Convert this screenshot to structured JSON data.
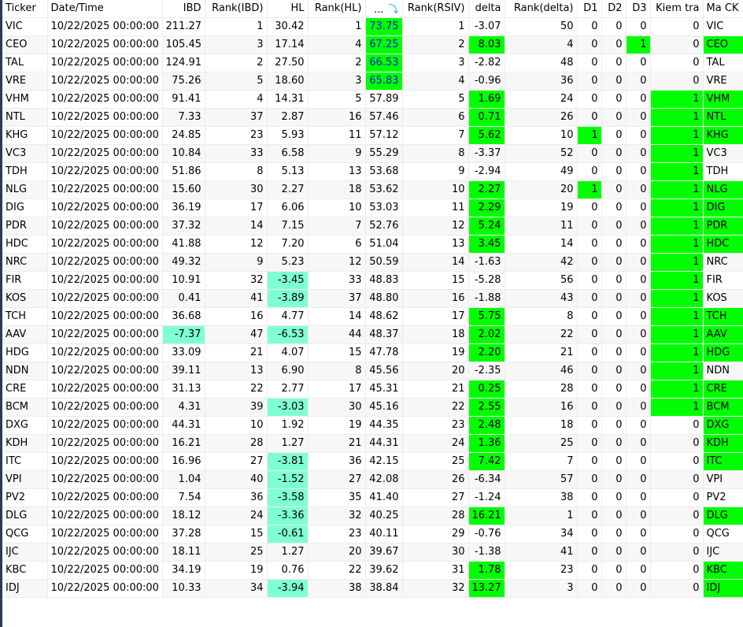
{
  "columns": [
    {
      "key": "ticker",
      "label": "Ticker",
      "align": "txt"
    },
    {
      "key": "dt",
      "label": "Date/Time",
      "align": "txt"
    },
    {
      "key": "ibd",
      "label": "IBD",
      "align": "num"
    },
    {
      "key": "rank_ibd",
      "label": "Rank(IBD)",
      "align": "num"
    },
    {
      "key": "hl",
      "label": "HL",
      "align": "num"
    },
    {
      "key": "rank_hl",
      "label": "Rank(HL)",
      "align": "num"
    },
    {
      "key": "rsi",
      "label": "...",
      "align": "num",
      "sorted": "sort-descending-icon"
    },
    {
      "key": "rank_rsiv",
      "label": "Rank(RSIV)",
      "align": "num"
    },
    {
      "key": "delta",
      "label": "delta",
      "align": "num"
    },
    {
      "key": "rank_delta",
      "label": "Rank(delta)",
      "align": "num"
    },
    {
      "key": "d1",
      "label": "D1",
      "align": "num"
    },
    {
      "key": "d2",
      "label": "D2",
      "align": "num"
    },
    {
      "key": "d3",
      "label": "D3",
      "align": "num"
    },
    {
      "key": "kiem_tra",
      "label": "Kiem tra",
      "align": "num"
    },
    {
      "key": "ma_ck",
      "label": "Ma CK",
      "align": "txt"
    }
  ],
  "colors": {
    "green": "#00ff00",
    "aquamarine": "#7fffd4",
    "blue_text": "#1515e0"
  },
  "rows": [
    {
      "ticker": "VIC",
      "dt": "10/22/2025 00:00:00",
      "ibd": "211.27",
      "rank_ibd": "1",
      "hl": "30.42",
      "rank_hl": "1",
      "rsi": "73.75",
      "rank_rsiv": "1",
      "delta": "-3.07",
      "rank_delta": "50",
      "d1": "0",
      "d2": "0",
      "d3": "0",
      "kiem_tra": "0",
      "ma_ck": "VIC",
      "green": [
        "rsi"
      ],
      "aqua": []
    },
    {
      "ticker": "CEO",
      "dt": "10/22/2025 00:00:00",
      "ibd": "105.45",
      "rank_ibd": "3",
      "hl": "17.14",
      "rank_hl": "4",
      "rsi": "67.25",
      "rank_rsiv": "2",
      "delta": "8.03",
      "rank_delta": "4",
      "d1": "0",
      "d2": "0",
      "d3": "1",
      "kiem_tra": "0",
      "ma_ck": "CEO",
      "green": [
        "rsi",
        "delta",
        "d3",
        "ma_ck"
      ],
      "aqua": []
    },
    {
      "ticker": "TAL",
      "dt": "10/22/2025 00:00:00",
      "ibd": "124.91",
      "rank_ibd": "2",
      "hl": "27.50",
      "rank_hl": "2",
      "rsi": "66.53",
      "rank_rsiv": "3",
      "delta": "-2.82",
      "rank_delta": "48",
      "d1": "0",
      "d2": "0",
      "d3": "0",
      "kiem_tra": "0",
      "ma_ck": "TAL",
      "green": [
        "rsi"
      ],
      "aqua": []
    },
    {
      "ticker": "VRE",
      "dt": "10/22/2025 00:00:00",
      "ibd": "75.26",
      "rank_ibd": "5",
      "hl": "18.60",
      "rank_hl": "3",
      "rsi": "65.83",
      "rank_rsiv": "4",
      "delta": "-0.96",
      "rank_delta": "36",
      "d1": "0",
      "d2": "0",
      "d3": "0",
      "kiem_tra": "0",
      "ma_ck": "VRE",
      "green": [
        "rsi"
      ],
      "aqua": []
    },
    {
      "ticker": "VHM",
      "dt": "10/22/2025 00:00:00",
      "ibd": "91.41",
      "rank_ibd": "4",
      "hl": "14.31",
      "rank_hl": "5",
      "rsi": "57.89",
      "rank_rsiv": "5",
      "delta": "1.69",
      "rank_delta": "24",
      "d1": "0",
      "d2": "0",
      "d3": "0",
      "kiem_tra": "1",
      "ma_ck": "VHM",
      "green": [
        "delta",
        "kiem_tra",
        "ma_ck"
      ],
      "aqua": []
    },
    {
      "ticker": "NTL",
      "dt": "10/22/2025 00:00:00",
      "ibd": "7.33",
      "rank_ibd": "37",
      "hl": "2.87",
      "rank_hl": "16",
      "rsi": "57.46",
      "rank_rsiv": "6",
      "delta": "0.71",
      "rank_delta": "26",
      "d1": "0",
      "d2": "0",
      "d3": "0",
      "kiem_tra": "1",
      "ma_ck": "NTL",
      "green": [
        "delta",
        "kiem_tra",
        "ma_ck"
      ],
      "aqua": []
    },
    {
      "ticker": "KHG",
      "dt": "10/22/2025 00:00:00",
      "ibd": "24.85",
      "rank_ibd": "23",
      "hl": "5.93",
      "rank_hl": "11",
      "rsi": "57.12",
      "rank_rsiv": "7",
      "delta": "5.62",
      "rank_delta": "10",
      "d1": "1",
      "d2": "0",
      "d3": "0",
      "kiem_tra": "1",
      "ma_ck": "KHG",
      "green": [
        "delta",
        "d1",
        "kiem_tra",
        "ma_ck"
      ],
      "aqua": []
    },
    {
      "ticker": "VC3",
      "dt": "10/22/2025 00:00:00",
      "ibd": "10.84",
      "rank_ibd": "33",
      "hl": "6.58",
      "rank_hl": "9",
      "rsi": "55.29",
      "rank_rsiv": "8",
      "delta": "-3.37",
      "rank_delta": "52",
      "d1": "0",
      "d2": "0",
      "d3": "0",
      "kiem_tra": "1",
      "ma_ck": "VC3",
      "green": [
        "kiem_tra"
      ],
      "aqua": []
    },
    {
      "ticker": "TDH",
      "dt": "10/22/2025 00:00:00",
      "ibd": "51.86",
      "rank_ibd": "8",
      "hl": "5.13",
      "rank_hl": "13",
      "rsi": "53.68",
      "rank_rsiv": "9",
      "delta": "-2.94",
      "rank_delta": "49",
      "d1": "0",
      "d2": "0",
      "d3": "0",
      "kiem_tra": "1",
      "ma_ck": "TDH",
      "green": [
        "kiem_tra"
      ],
      "aqua": []
    },
    {
      "ticker": "NLG",
      "dt": "10/22/2025 00:00:00",
      "ibd": "15.60",
      "rank_ibd": "30",
      "hl": "2.27",
      "rank_hl": "18",
      "rsi": "53.62",
      "rank_rsiv": "10",
      "delta": "2.27",
      "rank_delta": "20",
      "d1": "1",
      "d2": "0",
      "d3": "0",
      "kiem_tra": "1",
      "ma_ck": "NLG",
      "green": [
        "delta",
        "d1",
        "kiem_tra",
        "ma_ck"
      ],
      "aqua": []
    },
    {
      "ticker": "DIG",
      "dt": "10/22/2025 00:00:00",
      "ibd": "36.19",
      "rank_ibd": "17",
      "hl": "6.06",
      "rank_hl": "10",
      "rsi": "53.03",
      "rank_rsiv": "11",
      "delta": "2.29",
      "rank_delta": "19",
      "d1": "0",
      "d2": "0",
      "d3": "0",
      "kiem_tra": "1",
      "ma_ck": "DIG",
      "green": [
        "delta",
        "kiem_tra",
        "ma_ck"
      ],
      "aqua": []
    },
    {
      "ticker": "PDR",
      "dt": "10/22/2025 00:00:00",
      "ibd": "37.32",
      "rank_ibd": "14",
      "hl": "7.15",
      "rank_hl": "7",
      "rsi": "52.76",
      "rank_rsiv": "12",
      "delta": "5.24",
      "rank_delta": "11",
      "d1": "0",
      "d2": "0",
      "d3": "0",
      "kiem_tra": "1",
      "ma_ck": "PDR",
      "green": [
        "delta",
        "kiem_tra",
        "ma_ck"
      ],
      "aqua": []
    },
    {
      "ticker": "HDC",
      "dt": "10/22/2025 00:00:00",
      "ibd": "41.88",
      "rank_ibd": "12",
      "hl": "7.20",
      "rank_hl": "6",
      "rsi": "51.04",
      "rank_rsiv": "13",
      "delta": "3.45",
      "rank_delta": "14",
      "d1": "0",
      "d2": "0",
      "d3": "0",
      "kiem_tra": "1",
      "ma_ck": "HDC",
      "green": [
        "delta",
        "kiem_tra",
        "ma_ck"
      ],
      "aqua": []
    },
    {
      "ticker": "NRC",
      "dt": "10/22/2025 00:00:00",
      "ibd": "49.32",
      "rank_ibd": "9",
      "hl": "5.23",
      "rank_hl": "12",
      "rsi": "50.59",
      "rank_rsiv": "14",
      "delta": "-1.63",
      "rank_delta": "42",
      "d1": "0",
      "d2": "0",
      "d3": "0",
      "kiem_tra": "1",
      "ma_ck": "NRC",
      "green": [
        "kiem_tra"
      ],
      "aqua": []
    },
    {
      "ticker": "FIR",
      "dt": "10/22/2025 00:00:00",
      "ibd": "10.91",
      "rank_ibd": "32",
      "hl": "-3.45",
      "rank_hl": "33",
      "rsi": "48.83",
      "rank_rsiv": "15",
      "delta": "-5.28",
      "rank_delta": "56",
      "d1": "0",
      "d2": "0",
      "d3": "0",
      "kiem_tra": "1",
      "ma_ck": "FIR",
      "green": [
        "kiem_tra"
      ],
      "aqua": [
        "hl"
      ]
    },
    {
      "ticker": "KOS",
      "dt": "10/22/2025 00:00:00",
      "ibd": "0.41",
      "rank_ibd": "41",
      "hl": "-3.89",
      "rank_hl": "37",
      "rsi": "48.80",
      "rank_rsiv": "16",
      "delta": "-1.88",
      "rank_delta": "43",
      "d1": "0",
      "d2": "0",
      "d3": "0",
      "kiem_tra": "1",
      "ma_ck": "KOS",
      "green": [
        "kiem_tra"
      ],
      "aqua": [
        "hl"
      ]
    },
    {
      "ticker": "TCH",
      "dt": "10/22/2025 00:00:00",
      "ibd": "36.68",
      "rank_ibd": "16",
      "hl": "4.77",
      "rank_hl": "14",
      "rsi": "48.62",
      "rank_rsiv": "17",
      "delta": "5.75",
      "rank_delta": "8",
      "d1": "0",
      "d2": "0",
      "d3": "0",
      "kiem_tra": "1",
      "ma_ck": "TCH",
      "green": [
        "delta",
        "kiem_tra",
        "ma_ck"
      ],
      "aqua": []
    },
    {
      "ticker": "AAV",
      "dt": "10/22/2025 00:00:00",
      "ibd": "-7.37",
      "rank_ibd": "47",
      "hl": "-6.53",
      "rank_hl": "44",
      "rsi": "48.37",
      "rank_rsiv": "18",
      "delta": "2.02",
      "rank_delta": "22",
      "d1": "0",
      "d2": "0",
      "d3": "0",
      "kiem_tra": "1",
      "ma_ck": "AAV",
      "green": [
        "delta",
        "kiem_tra",
        "ma_ck"
      ],
      "aqua": [
        "ibd",
        "hl"
      ]
    },
    {
      "ticker": "HDG",
      "dt": "10/22/2025 00:00:00",
      "ibd": "33.09",
      "rank_ibd": "21",
      "hl": "4.07",
      "rank_hl": "15",
      "rsi": "47.78",
      "rank_rsiv": "19",
      "delta": "2.20",
      "rank_delta": "21",
      "d1": "0",
      "d2": "0",
      "d3": "0",
      "kiem_tra": "1",
      "ma_ck": "HDG",
      "green": [
        "delta",
        "kiem_tra",
        "ma_ck"
      ],
      "aqua": []
    },
    {
      "ticker": "NDN",
      "dt": "10/22/2025 00:00:00",
      "ibd": "39.11",
      "rank_ibd": "13",
      "hl": "6.90",
      "rank_hl": "8",
      "rsi": "45.56",
      "rank_rsiv": "20",
      "delta": "-2.35",
      "rank_delta": "46",
      "d1": "0",
      "d2": "0",
      "d3": "0",
      "kiem_tra": "1",
      "ma_ck": "NDN",
      "green": [
        "kiem_tra"
      ],
      "aqua": []
    },
    {
      "ticker": "CRE",
      "dt": "10/22/2025 00:00:00",
      "ibd": "31.13",
      "rank_ibd": "22",
      "hl": "2.77",
      "rank_hl": "17",
      "rsi": "45.31",
      "rank_rsiv": "21",
      "delta": "0.25",
      "rank_delta": "28",
      "d1": "0",
      "d2": "0",
      "d3": "0",
      "kiem_tra": "1",
      "ma_ck": "CRE",
      "green": [
        "delta",
        "kiem_tra",
        "ma_ck"
      ],
      "aqua": []
    },
    {
      "ticker": "BCM",
      "dt": "10/22/2025 00:00:00",
      "ibd": "4.31",
      "rank_ibd": "39",
      "hl": "-3.03",
      "rank_hl": "30",
      "rsi": "45.16",
      "rank_rsiv": "22",
      "delta": "2.55",
      "rank_delta": "16",
      "d1": "0",
      "d2": "0",
      "d3": "0",
      "kiem_tra": "1",
      "ma_ck": "BCM",
      "green": [
        "delta",
        "kiem_tra",
        "ma_ck"
      ],
      "aqua": [
        "hl"
      ]
    },
    {
      "ticker": "DXG",
      "dt": "10/22/2025 00:00:00",
      "ibd": "44.31",
      "rank_ibd": "10",
      "hl": "1.92",
      "rank_hl": "19",
      "rsi": "44.35",
      "rank_rsiv": "23",
      "delta": "2.48",
      "rank_delta": "18",
      "d1": "0",
      "d2": "0",
      "d3": "0",
      "kiem_tra": "0",
      "ma_ck": "DXG",
      "green": [
        "delta",
        "ma_ck"
      ],
      "aqua": []
    },
    {
      "ticker": "KDH",
      "dt": "10/22/2025 00:00:00",
      "ibd": "16.21",
      "rank_ibd": "28",
      "hl": "1.27",
      "rank_hl": "21",
      "rsi": "44.31",
      "rank_rsiv": "24",
      "delta": "1.36",
      "rank_delta": "25",
      "d1": "0",
      "d2": "0",
      "d3": "0",
      "kiem_tra": "0",
      "ma_ck": "KDH",
      "green": [
        "delta",
        "ma_ck"
      ],
      "aqua": []
    },
    {
      "ticker": "ITC",
      "dt": "10/22/2025 00:00:00",
      "ibd": "16.96",
      "rank_ibd": "27",
      "hl": "-3.81",
      "rank_hl": "36",
      "rsi": "42.15",
      "rank_rsiv": "25",
      "delta": "7.42",
      "rank_delta": "7",
      "d1": "0",
      "d2": "0",
      "d3": "0",
      "kiem_tra": "0",
      "ma_ck": "ITC",
      "green": [
        "delta",
        "ma_ck"
      ],
      "aqua": [
        "hl"
      ]
    },
    {
      "ticker": "VPI",
      "dt": "10/22/2025 00:00:00",
      "ibd": "1.04",
      "rank_ibd": "40",
      "hl": "-1.52",
      "rank_hl": "27",
      "rsi": "42.08",
      "rank_rsiv": "26",
      "delta": "-6.34",
      "rank_delta": "57",
      "d1": "0",
      "d2": "0",
      "d3": "0",
      "kiem_tra": "0",
      "ma_ck": "VPI",
      "green": [],
      "aqua": [
        "hl"
      ]
    },
    {
      "ticker": "PV2",
      "dt": "10/22/2025 00:00:00",
      "ibd": "7.54",
      "rank_ibd": "36",
      "hl": "-3.58",
      "rank_hl": "35",
      "rsi": "41.40",
      "rank_rsiv": "27",
      "delta": "-1.24",
      "rank_delta": "38",
      "d1": "0",
      "d2": "0",
      "d3": "0",
      "kiem_tra": "0",
      "ma_ck": "PV2",
      "green": [],
      "aqua": [
        "hl"
      ]
    },
    {
      "ticker": "DLG",
      "dt": "10/22/2025 00:00:00",
      "ibd": "18.12",
      "rank_ibd": "24",
      "hl": "-3.36",
      "rank_hl": "32",
      "rsi": "40.25",
      "rank_rsiv": "28",
      "delta": "16.21",
      "rank_delta": "1",
      "d1": "0",
      "d2": "0",
      "d3": "0",
      "kiem_tra": "0",
      "ma_ck": "DLG",
      "green": [
        "delta",
        "ma_ck"
      ],
      "aqua": [
        "hl"
      ]
    },
    {
      "ticker": "QCG",
      "dt": "10/22/2025 00:00:00",
      "ibd": "37.28",
      "rank_ibd": "15",
      "hl": "-0.61",
      "rank_hl": "23",
      "rsi": "40.11",
      "rank_rsiv": "29",
      "delta": "-0.76",
      "rank_delta": "34",
      "d1": "0",
      "d2": "0",
      "d3": "0",
      "kiem_tra": "0",
      "ma_ck": "QCG",
      "green": [],
      "aqua": [
        "hl"
      ]
    },
    {
      "ticker": "IJC",
      "dt": "10/22/2025 00:00:00",
      "ibd": "18.11",
      "rank_ibd": "25",
      "hl": "1.27",
      "rank_hl": "20",
      "rsi": "39.67",
      "rank_rsiv": "30",
      "delta": "-1.38",
      "rank_delta": "41",
      "d1": "0",
      "d2": "0",
      "d3": "0",
      "kiem_tra": "0",
      "ma_ck": "IJC",
      "green": [],
      "aqua": []
    },
    {
      "ticker": "KBC",
      "dt": "10/22/2025 00:00:00",
      "ibd": "34.19",
      "rank_ibd": "19",
      "hl": "0.76",
      "rank_hl": "22",
      "rsi": "39.62",
      "rank_rsiv": "31",
      "delta": "1.78",
      "rank_delta": "23",
      "d1": "0",
      "d2": "0",
      "d3": "0",
      "kiem_tra": "0",
      "ma_ck": "KBC",
      "green": [
        "delta",
        "ma_ck"
      ],
      "aqua": []
    },
    {
      "ticker": "IDJ",
      "dt": "10/22/2025 00:00:00",
      "ibd": "10.33",
      "rank_ibd": "34",
      "hl": "-3.94",
      "rank_hl": "38",
      "rsi": "38.84",
      "rank_rsiv": "32",
      "delta": "13.27",
      "rank_delta": "3",
      "d1": "0",
      "d2": "0",
      "d3": "0",
      "kiem_tra": "0",
      "ma_ck": "IDJ",
      "green": [
        "delta",
        "ma_ck"
      ],
      "aqua": [
        "hl"
      ]
    }
  ]
}
